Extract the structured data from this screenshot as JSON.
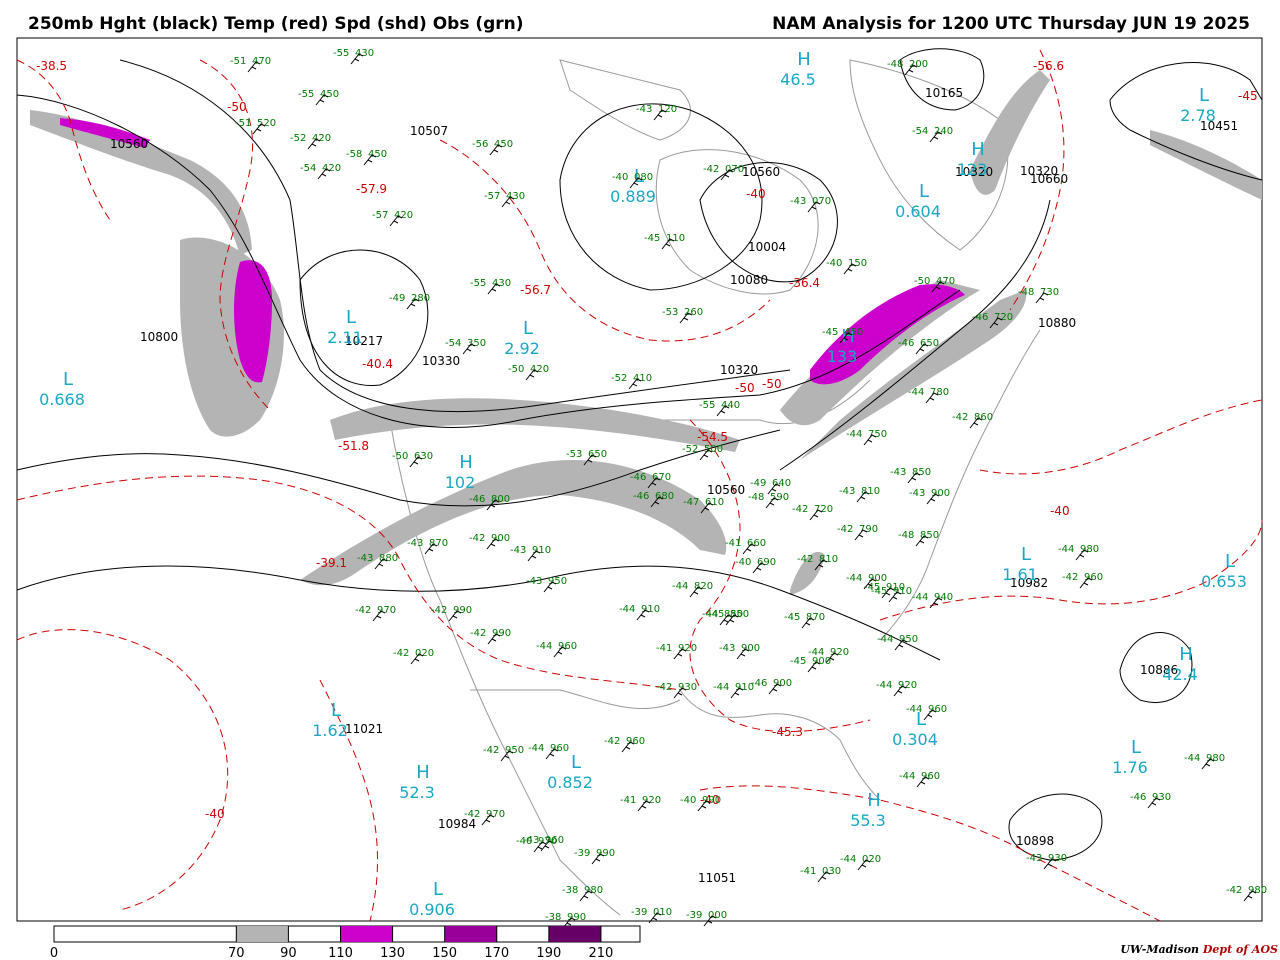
{
  "header": {
    "left_title": "250mb Hght (black) Temp (red) Spd (shd) Obs (grn)",
    "right_title": "NAM Analysis for 1200 UTC Thursday  JUN 19 2025"
  },
  "credit": {
    "org": "UW-Madison",
    "dept": "Dept of AOS"
  },
  "colors": {
    "height_contour": "#000000",
    "temperature_contour": "#cc0000",
    "speed_70_90": "#b4b4b4",
    "speed_110_130": "#cc00cc",
    "speed_150_170": "#990099",
    "speed_190_210": "#660066",
    "observations": "#007a00",
    "wind_centers": "#1aa7c4",
    "borders": "#9a9a9a"
  },
  "legend": {
    "ticks": [
      "0",
      "70",
      "90",
      "110",
      "130",
      "150",
      "170",
      "190",
      "210"
    ],
    "shaded_ranges": [
      {
        "from": 70,
        "to": 90,
        "color": "#b4b4b4"
      },
      {
        "from": 110,
        "to": 130,
        "color": "#cc00cc"
      },
      {
        "from": 150,
        "to": 170,
        "color": "#990099"
      },
      {
        "from": 190,
        "to": 210,
        "color": "#660066"
      }
    ]
  },
  "height_labels": [
    "10800",
    "10217",
    "10330",
    "10320",
    "10080",
    "10004",
    "10320",
    "10560",
    "10165",
    "10320",
    "10660",
    "10451",
    "10880",
    "10560",
    "10982",
    "10886",
    "11021",
    "10984",
    "11051",
    "10898",
    "10507",
    "10560"
  ],
  "temperature_labels": [
    "-38.5",
    "-50",
    "-57.9",
    "-50",
    "-40.4",
    "-51.8",
    "-39.1",
    "-56.7",
    "-36.4",
    "-50",
    "-54.5",
    "-40",
    "-40",
    "-56.6",
    "-45.3",
    "-45",
    "-40",
    "-40"
  ],
  "isotach_centers": [
    {
      "letter": "L",
      "value": "0.668"
    },
    {
      "letter": "L",
      "value": "2.11"
    },
    {
      "letter": "L",
      "value": "2.92"
    },
    {
      "letter": "L",
      "value": "0.604"
    },
    {
      "letter": "L",
      "value": "0.889"
    },
    {
      "letter": "L",
      "value": "1.62"
    },
    {
      "letter": "H",
      "value": "52.3"
    },
    {
      "letter": "L",
      "value": "0.852"
    },
    {
      "letter": "L",
      "value": "0.304"
    },
    {
      "letter": "H",
      "value": "55.3"
    },
    {
      "letter": "L",
      "value": "1.76"
    },
    {
      "letter": "L",
      "value": "0.653"
    },
    {
      "letter": "H",
      "value": "42.4"
    },
    {
      "letter": "L",
      "value": "0.906"
    },
    {
      "letter": "H",
      "value": "46.5"
    },
    {
      "letter": "L",
      "value": "2.78"
    },
    {
      "letter": "H",
      "value": "102"
    },
    {
      "letter": "H",
      "value": "123"
    },
    {
      "letter": "H",
      "value": "133"
    },
    {
      "letter": "L",
      "value": "1.61"
    }
  ],
  "observations": [
    {
      "t": "-51",
      "h": "470"
    },
    {
      "t": "-55",
      "h": "430"
    },
    {
      "t": "-55",
      "h": "450"
    },
    {
      "t": "-51",
      "h": "520"
    },
    {
      "t": "-52",
      "h": "420"
    },
    {
      "t": "-54",
      "h": "420"
    },
    {
      "t": "-58",
      "h": "450"
    },
    {
      "t": "-57",
      "h": "420"
    },
    {
      "t": "-56",
      "h": "450"
    },
    {
      "t": "-57",
      "h": "430"
    },
    {
      "t": "-49",
      "h": "280"
    },
    {
      "t": "-54",
      "h": "350"
    },
    {
      "t": "-43",
      "h": "120"
    },
    {
      "t": "-40",
      "h": "080"
    },
    {
      "t": "-42",
      "h": "070"
    },
    {
      "t": "-43",
      "h": "070"
    },
    {
      "t": "-48",
      "h": "200"
    },
    {
      "t": "-54",
      "h": "240"
    },
    {
      "t": "-45",
      "h": "110"
    },
    {
      "t": "-40",
      "h": "150"
    },
    {
      "t": "-55",
      "h": "430"
    },
    {
      "t": "-53",
      "h": "260"
    },
    {
      "t": "-50",
      "h": "470"
    },
    {
      "t": "-48",
      "h": "730"
    },
    {
      "t": "-46",
      "h": "720"
    },
    {
      "t": "-45",
      "h": "450"
    },
    {
      "t": "-46",
      "h": "650"
    },
    {
      "t": "-52",
      "h": "410"
    },
    {
      "t": "-50",
      "h": "420"
    },
    {
      "t": "-55",
      "h": "440"
    },
    {
      "t": "-44",
      "h": "780"
    },
    {
      "t": "-42",
      "h": "860"
    },
    {
      "t": "-50",
      "h": "630"
    },
    {
      "t": "-52",
      "h": "500"
    },
    {
      "t": "-44",
      "h": "750"
    },
    {
      "t": "-53",
      "h": "650"
    },
    {
      "t": "-46",
      "h": "670"
    },
    {
      "t": "-46",
      "h": "680"
    },
    {
      "t": "-43",
      "h": "850"
    },
    {
      "t": "-49",
      "h": "640"
    },
    {
      "t": "-47",
      "h": "610"
    },
    {
      "t": "-48",
      "h": "590"
    },
    {
      "t": "-46",
      "h": "800"
    },
    {
      "t": "-43",
      "h": "810"
    },
    {
      "t": "-43",
      "h": "900"
    },
    {
      "t": "-42",
      "h": "720"
    },
    {
      "t": "-42",
      "h": "790"
    },
    {
      "t": "-41",
      "h": "660"
    },
    {
      "t": "-43",
      "h": "870"
    },
    {
      "t": "-42",
      "h": "900"
    },
    {
      "t": "-45",
      "h": "910"
    },
    {
      "t": "-48",
      "h": "850"
    },
    {
      "t": "-43",
      "h": "880"
    },
    {
      "t": "-43",
      "h": "910"
    },
    {
      "t": "-40",
      "h": "690"
    },
    {
      "t": "-42",
      "h": "810"
    },
    {
      "t": "-44",
      "h": "980"
    },
    {
      "t": "-44",
      "h": "900"
    },
    {
      "t": "-45",
      "h": "910"
    },
    {
      "t": "-44",
      "h": "940"
    },
    {
      "t": "-43",
      "h": "950"
    },
    {
      "t": "-44",
      "h": "820"
    },
    {
      "t": "-44",
      "h": "850"
    },
    {
      "t": "-42",
      "h": "970"
    },
    {
      "t": "-42",
      "h": "990"
    },
    {
      "t": "-42",
      "h": "990"
    },
    {
      "t": "-44",
      "h": "910"
    },
    {
      "t": "-45",
      "h": "850"
    },
    {
      "t": "-45",
      "h": "870"
    },
    {
      "t": "-44",
      "h": "920"
    },
    {
      "t": "-44",
      "h": "950"
    },
    {
      "t": "-42",
      "h": "020"
    },
    {
      "t": "-44",
      "h": "960"
    },
    {
      "t": "-41",
      "h": "920"
    },
    {
      "t": "-43",
      "h": "900"
    },
    {
      "t": "-45",
      "h": "900"
    },
    {
      "t": "-44",
      "h": "920"
    },
    {
      "t": "-44",
      "h": "960"
    },
    {
      "t": "-42",
      "h": "930"
    },
    {
      "t": "-44",
      "h": "910"
    },
    {
      "t": "-46",
      "h": "900"
    },
    {
      "t": "-44",
      "h": "960"
    },
    {
      "t": "-42",
      "h": "960"
    },
    {
      "t": "-42",
      "h": "950"
    },
    {
      "t": "-44",
      "h": "960"
    },
    {
      "t": "-42",
      "h": "970"
    },
    {
      "t": "-43",
      "h": "960"
    },
    {
      "t": "-41",
      "h": "920"
    },
    {
      "t": "-40",
      "h": "990"
    },
    {
      "t": "-40",
      "h": "970"
    },
    {
      "t": "-39",
      "h": "990"
    },
    {
      "t": "-38",
      "h": "980"
    },
    {
      "t": "-38",
      "h": "990"
    },
    {
      "t": "-39",
      "h": "010"
    },
    {
      "t": "-39",
      "h": "000"
    },
    {
      "t": "-41",
      "h": "030"
    },
    {
      "t": "-44",
      "h": "020"
    },
    {
      "t": "-44",
      "h": "980"
    },
    {
      "t": "-46",
      "h": "930"
    },
    {
      "t": "-43",
      "h": "930"
    },
    {
      "t": "-42",
      "h": "980"
    },
    {
      "t": "-42",
      "h": "960"
    }
  ]
}
